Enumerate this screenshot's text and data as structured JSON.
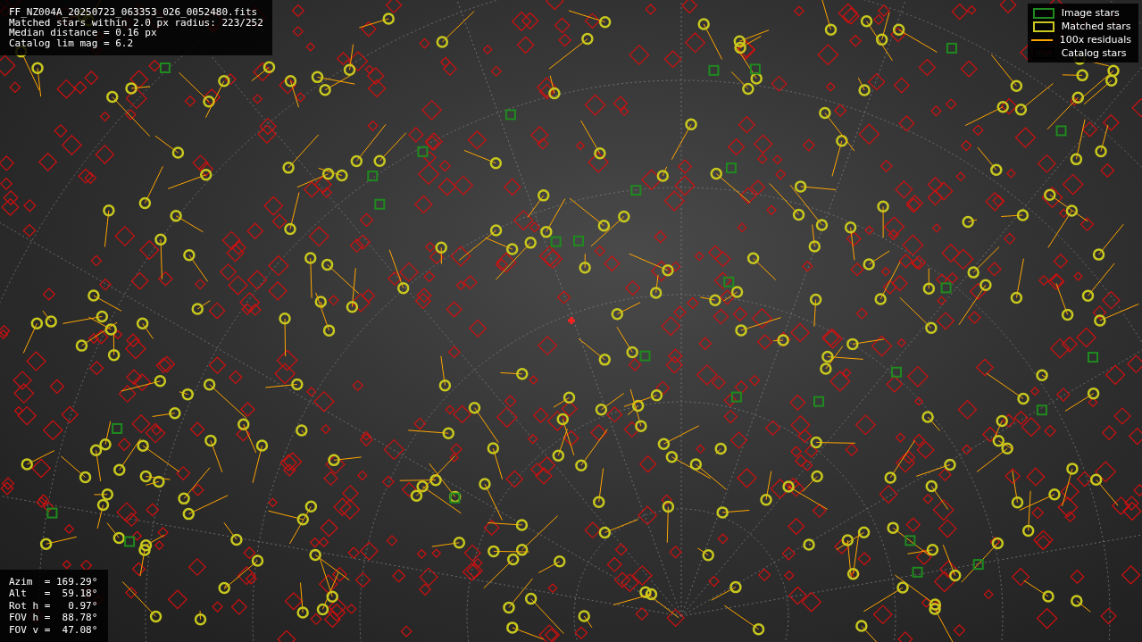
{
  "header": {
    "lines": [
      "FF_NZ004A_20250723_063353_026_0052480.fits",
      "Matched stars within 2.0 px radius: 223/252",
      "Median distance = 0.16 px",
      "Catalog lim mag = 6.2"
    ]
  },
  "legend": [
    {
      "kind": "box",
      "label": "Image stars",
      "color": "#1f8a1f"
    },
    {
      "kind": "box",
      "label": "Matched stars",
      "color": "#c8c81e"
    },
    {
      "kind": "line",
      "label": "100x residuals",
      "color": "#ffa500"
    },
    {
      "kind": "box",
      "label": "Catalog stars",
      "color": "#000000"
    }
  ],
  "pointing": {
    "lines": [
      "Azim  = 169.29°",
      "Alt   =  59.18°",
      "Rot h =   0.97°",
      "FOV h =  88.78°",
      "FOV v =  47.08°"
    ]
  }
}
